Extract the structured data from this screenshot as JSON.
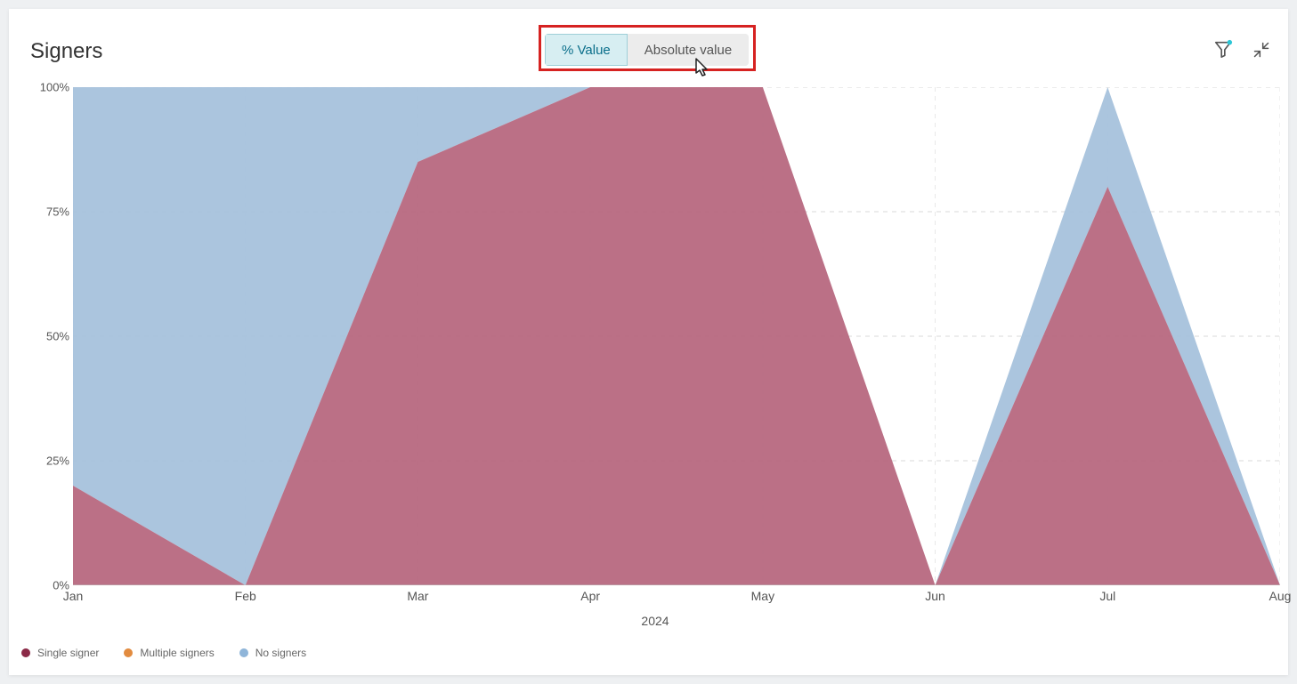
{
  "header": {
    "title": "Signers",
    "toggle": {
      "percent_label": "% Value",
      "absolute_label": "Absolute value"
    }
  },
  "chart_data": {
    "type": "area",
    "stacked": true,
    "title": "Signers",
    "xlabel": "2024",
    "ylabel": "",
    "ylim": [
      0,
      100
    ],
    "y_ticks": [
      "0%",
      "25%",
      "50%",
      "75%",
      "100%"
    ],
    "categories": [
      "Jan",
      "Feb",
      "Mar",
      "Apr",
      "May",
      "Jun",
      "Jul",
      "Aug"
    ],
    "series": [
      {
        "name": "Single signer",
        "color": "#b7687f",
        "values": [
          20,
          0,
          85,
          100,
          100,
          0,
          80,
          0
        ]
      },
      {
        "name": "Multiple signers",
        "color": "#e69a5a",
        "values": [
          0,
          0,
          0,
          0,
          0,
          0,
          0,
          0
        ]
      },
      {
        "name": "No signers",
        "color": "#a7c2dc",
        "values": [
          80,
          100,
          15,
          0,
          0,
          0,
          20,
          0
        ]
      }
    ],
    "x_year": "2024",
    "legend_position": "bottom-left",
    "grid": true
  },
  "legend": {
    "items": [
      {
        "label": "Single signer",
        "color": "#8b2a47"
      },
      {
        "label": "Multiple signers",
        "color": "#e28b3f"
      },
      {
        "label": "No signers",
        "color": "#8fb5d9"
      }
    ]
  }
}
